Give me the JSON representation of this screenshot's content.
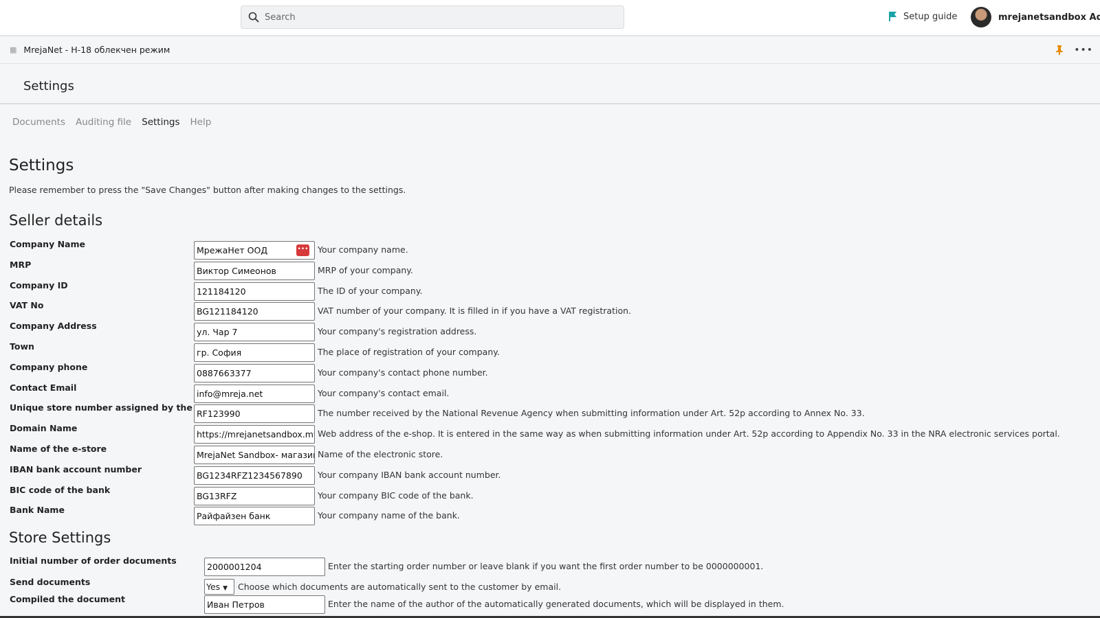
{
  "topbar": {
    "search_placeholder": "Search",
    "setup_guide": "Setup guide",
    "user": "mrejanetsandbox Admin"
  },
  "app": {
    "title": "MrejaNet - Н-18 облекчен режим"
  },
  "page": {
    "header": "Settings",
    "tabs": [
      {
        "label": "Documents"
      },
      {
        "label": "Auditing file"
      },
      {
        "label": "Settings",
        "active": true
      },
      {
        "label": "Help"
      }
    ],
    "title": "Settings",
    "note": "Please remember to press the \"Save Changes\" button after making changes to the settings."
  },
  "seller": {
    "title": "Seller details",
    "rows": [
      {
        "label": "Company Name",
        "value": "МрежаНет ООД",
        "desc": "Your company name."
      },
      {
        "label": "MRP",
        "value": "Виктор Симеонов",
        "desc": "MRP of your company."
      },
      {
        "label": "Company ID",
        "value": "121184120",
        "desc": "The ID of your company."
      },
      {
        "label": "VAT No",
        "value": "BG121184120",
        "desc": "VAT number of your company. It is filled in if you have a VAT registration."
      },
      {
        "label": "Company Address",
        "value": "ул. Чар 7",
        "desc": "Your company's registration address."
      },
      {
        "label": "Town",
        "value": "гр. София",
        "desc": "The place of registration of your company."
      },
      {
        "label": "Company phone",
        "value": "0887663377",
        "desc": "Your company's contact phone number."
      },
      {
        "label": "Contact Email",
        "value": "info@mreja.net",
        "desc": "Your company's contact email."
      },
      {
        "label": "Unique store number assigned by the NRA",
        "value": "RF123990",
        "desc": "The number received by the National Revenue Agency when submitting information under Art. 52p according to Annex No. 33."
      },
      {
        "label": "Domain Name",
        "value": "https://mrejanetsandbox.myshopify.com",
        "desc": "Web address of the e-shop. It is entered in the same way as when submitting information under Art. 52p according to Appendix No. 33 in the NRA electronic services portal."
      },
      {
        "label": "Name of the e-store",
        "value": "MrejaNet Sandbox- магазин",
        "desc": "Name of the electronic store."
      },
      {
        "label": "IBAN bank account number",
        "value": "BG1234RFZ1234567890",
        "desc": "Your company IBAN bank account number."
      },
      {
        "label": "BIC code of the bank",
        "value": "BG13RFZ",
        "desc": "Your company BIC code of the bank."
      },
      {
        "label": "Bank Name",
        "value": "Райфайзен банк",
        "desc": "Your company name of the bank."
      }
    ]
  },
  "store": {
    "title": "Store Settings",
    "initial_number": {
      "label": "Initial number of order documents",
      "value": "2000001204",
      "desc": "Enter the starting order number or leave blank if you want the first order number to be 0000000001."
    },
    "send_documents": {
      "label": "Send documents",
      "value": "Yes",
      "desc": "Choose which documents are automatically sent to the customer by email."
    },
    "compiled": {
      "label": "Compiled the document",
      "value": "Иван Петров",
      "desc": "Enter the name of the author of the automatically generated documents, which will be displayed in them."
    }
  },
  "colors": {
    "flag": "#1aa3a8",
    "pin": "#e58a00",
    "password_icon": "#d63a3a"
  }
}
